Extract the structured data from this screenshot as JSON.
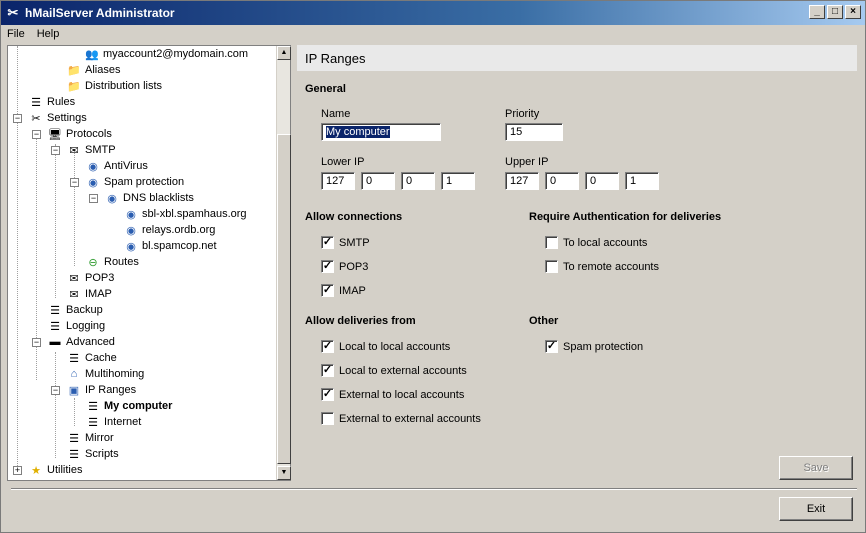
{
  "window": {
    "title": "hMailServer Administrator"
  },
  "menu": {
    "file": "File",
    "help": "Help"
  },
  "tree": {
    "myaccount2": "myaccount2@mydomain.com",
    "aliases": "Aliases",
    "distribution_lists": "Distribution lists",
    "rules": "Rules",
    "settings": "Settings",
    "protocols": "Protocols",
    "smtp": "SMTP",
    "antivirus": "AntiVirus",
    "spam_protection": "Spam protection",
    "dns_blacklists": "DNS blacklists",
    "bl1": "sbl-xbl.spamhaus.org",
    "bl2": "relays.ordb.org",
    "bl3": "bl.spamcop.net",
    "routes": "Routes",
    "pop3": "POP3",
    "imap": "IMAP",
    "backup": "Backup",
    "logging": "Logging",
    "advanced": "Advanced",
    "cache": "Cache",
    "multihoming": "Multihoming",
    "ip_ranges": "IP Ranges",
    "my_computer": "My computer",
    "internet": "Internet",
    "mirror": "Mirror",
    "scripts": "Scripts",
    "utilities": "Utilities"
  },
  "panel": {
    "title": "IP Ranges",
    "general": "General",
    "name_label": "Name",
    "name_value": "My computer",
    "priority_label": "Priority",
    "priority_value": "15",
    "lower_ip_label": "Lower IP",
    "lower_ip": [
      "127",
      "0",
      "0",
      "1"
    ],
    "upper_ip_label": "Upper IP",
    "upper_ip": [
      "127",
      "0",
      "0",
      "1"
    ],
    "allow_connections": "Allow connections",
    "smtp": "SMTP",
    "pop3": "POP3",
    "imap": "IMAP",
    "require_auth": "Require Authentication for deliveries",
    "to_local": "To local accounts",
    "to_remote": "To remote accounts",
    "allow_deliveries": "Allow deliveries from",
    "local_local": "Local to local accounts",
    "local_external": "Local to external accounts",
    "external_local": "External to local accounts",
    "external_external": "External to external accounts",
    "other": "Other",
    "spam_protection": "Spam protection",
    "save": "Save",
    "exit": "Exit"
  }
}
